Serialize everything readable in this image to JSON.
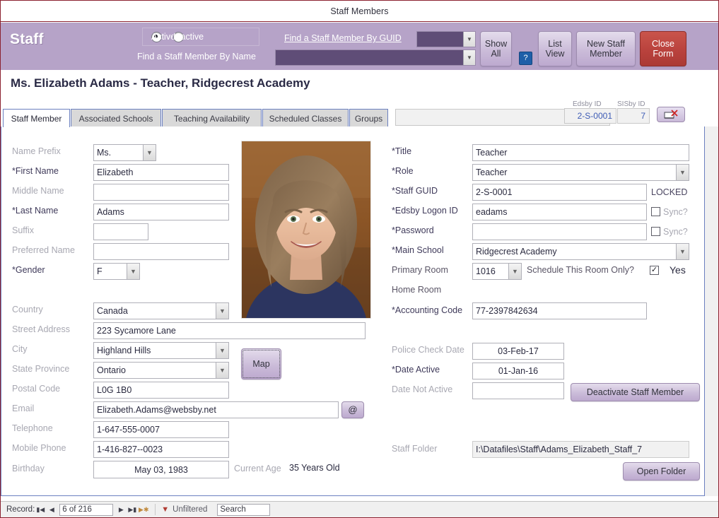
{
  "window": {
    "title": "Staff Members"
  },
  "header": {
    "brand": "Staff",
    "status_options": [
      {
        "label": "Active",
        "selected": true
      },
      {
        "label": "Inactive",
        "selected": false
      }
    ],
    "find_by_guid_label": "Find a Staff Member By GUID",
    "find_by_guid_value": "",
    "find_by_name_label": "Find a Staff Member By Name",
    "find_by_name_value": "",
    "buttons": {
      "show_all": "Show All",
      "help": "?",
      "list_view": "List View",
      "new_staff_member": "New Staff Member",
      "close_form": "Close Form"
    },
    "accent_purple": "#b6a3c8",
    "accent_red": "#b8413c",
    "accent_blue": "#1f5fa8"
  },
  "person_line": "Ms. Elizabeth  Adams  - Teacher, Ridgecrest Academy",
  "tabs": [
    {
      "label": "Staff Member",
      "active": true
    },
    {
      "label": "Associated Schools",
      "active": false
    },
    {
      "label": "Teaching Availability",
      "active": false
    },
    {
      "label": "Scheduled Classes",
      "active": false
    },
    {
      "label": "Groups",
      "active": false
    }
  ],
  "ids": {
    "edsby_label": "Edsby ID",
    "edsby_value": "2-S-0001",
    "sisby_label": "SISby ID",
    "sisby_value": "7",
    "unlink_icon": "unlink-record-icon"
  },
  "left_form": {
    "name_prefix": {
      "label": "Name Prefix",
      "value": "Ms.",
      "required": false
    },
    "first_name": {
      "label": "*First Name",
      "value": "Elizabeth",
      "required": true
    },
    "middle_name": {
      "label": "Middle Name",
      "value": "",
      "required": false
    },
    "last_name": {
      "label": "*Last Name",
      "value": "Adams",
      "required": true
    },
    "suffix": {
      "label": "Suffix",
      "value": "",
      "required": false
    },
    "preferred_name": {
      "label": "Preferred Name",
      "value": "",
      "required": false
    },
    "gender": {
      "label": "*Gender",
      "value": "F",
      "required": true
    },
    "country": {
      "label": "Country",
      "value": "Canada",
      "required": false
    },
    "street_address": {
      "label": "Street Address",
      "value": "223 Sycamore Lane",
      "required": false
    },
    "city": {
      "label": "City",
      "value": "Highland Hills",
      "required": false
    },
    "state_province": {
      "label": "State Province",
      "value": "Ontario",
      "required": false
    },
    "postal_code": {
      "label": "Postal Code",
      "value": "L0G 1B0",
      "required": false
    },
    "email": {
      "label": "Email",
      "value": "Elizabeth.Adams@websby.net",
      "required": false
    },
    "telephone": {
      "label": "Telephone",
      "value": "1-647-555-0007",
      "required": false
    },
    "mobile_phone": {
      "label": "Mobile Phone",
      "value": "1-416-827--0023",
      "required": false
    },
    "birthday": {
      "label": "Birthday",
      "value": "May 03, 1983",
      "required": false
    },
    "map_button": "Map",
    "email_button": "@",
    "current_age_label": "Current Age",
    "current_age_value": "35 Years Old"
  },
  "right_form": {
    "title": {
      "label": "*Title",
      "value": "Teacher"
    },
    "role": {
      "label": "*Role",
      "value": "Teacher"
    },
    "staff_guid": {
      "label": "*Staff GUID",
      "value": "2-S-0001",
      "suffix": "LOCKED"
    },
    "edsby_logon_id": {
      "label": "*Edsby Logon ID",
      "value": "eadams",
      "sync_label": "Sync?",
      "sync_checked": false
    },
    "password": {
      "label": "*Password",
      "value": "",
      "sync_label": "Sync?",
      "sync_checked": false
    },
    "main_school": {
      "label": "*Main School",
      "value": "Ridgecrest Academy"
    },
    "primary_room": {
      "label": "Primary Room",
      "value": "1016"
    },
    "schedule_room_only": {
      "label": "Schedule This Room Only?",
      "checked": true,
      "yes_label": "Yes"
    },
    "home_room": {
      "label": "Home Room",
      "value": ""
    },
    "accounting_code": {
      "label": "*Accounting Code",
      "value": "77-2397842634"
    },
    "police_check_date": {
      "label": "Police Check Date",
      "value": "03-Feb-17"
    },
    "date_active": {
      "label": "*Date Active",
      "value": "01-Jan-16"
    },
    "date_not_active": {
      "label": "Date Not Active",
      "value": ""
    },
    "deactivate_button": "Deactivate Staff Member",
    "staff_folder": {
      "label": "Staff Folder",
      "value": "I:\\Datafiles\\Staff\\Adams_Elizabeth_Staff_7"
    },
    "open_folder_button": "Open Folder"
  },
  "footer": {
    "record_label": "Record:",
    "record_value": "6 of 216",
    "filter_status": "Unfiltered",
    "search_placeholder": "Search",
    "search_value": "Search"
  }
}
